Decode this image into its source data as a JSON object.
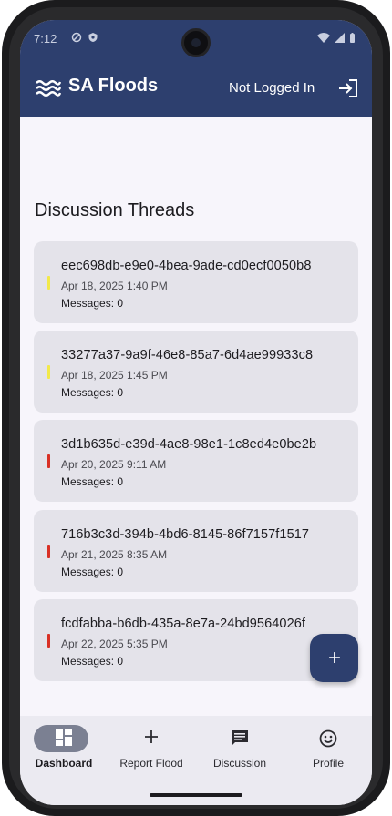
{
  "status_bar": {
    "time": "7:12"
  },
  "app_bar": {
    "title": "SA Floods",
    "login_status": "Not Logged In",
    "logo_icon": "waves-icon",
    "login_icon": "login-icon",
    "background_color": "#2d3f6e"
  },
  "main": {
    "section_title": "Discussion Threads",
    "threads": [
      {
        "id": "eec698db-e9e0-4bea-9ade-cd0ecf0050b8",
        "date": "Apr 18, 2025 1:40 PM",
        "messages": "Messages: 0",
        "severity_color": "#f2e94a"
      },
      {
        "id": "33277a37-9a9f-46e8-85a7-6d4ae99933c8",
        "date": "Apr 18, 2025 1:45 PM",
        "messages": "Messages: 0",
        "severity_color": "#f2e94a"
      },
      {
        "id": "3d1b635d-e39d-4ae8-98e1-1c8ed4e0be2b",
        "date": "Apr 20, 2025 9:11 AM",
        "messages": "Messages: 0",
        "severity_color": "#d93025"
      },
      {
        "id": "716b3c3d-394b-4bd6-8145-86f7157f1517",
        "date": "Apr 21, 2025 8:35 AM",
        "messages": "Messages: 0",
        "severity_color": "#d93025"
      },
      {
        "id": "fcdfabba-b6db-435a-8e7a-24bd9564026f",
        "date": "Apr 22, 2025 5:35 PM",
        "messages": "Messages: 0",
        "severity_color": "#d93025"
      }
    ]
  },
  "fab": {
    "label": "+",
    "icon": "plus-icon"
  },
  "bottom_nav": {
    "items": [
      {
        "label": "Dashboard",
        "icon": "dashboard-icon",
        "active": true
      },
      {
        "label": "Report Flood",
        "icon": "plus-icon",
        "active": false
      },
      {
        "label": "Discussion",
        "icon": "chat-icon",
        "active": false
      },
      {
        "label": "Profile",
        "icon": "smiley-icon",
        "active": false
      }
    ]
  }
}
